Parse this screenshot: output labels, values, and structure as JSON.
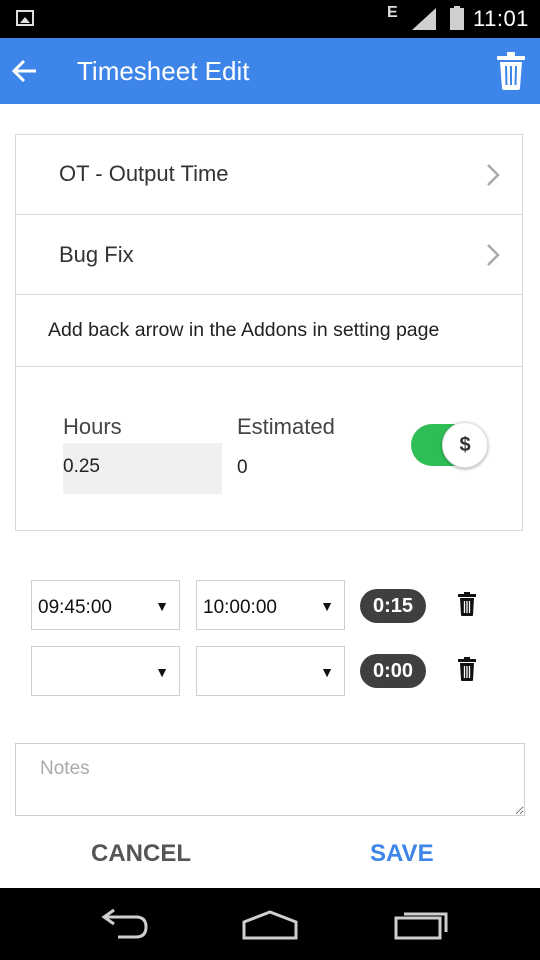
{
  "status_bar": {
    "network": "E",
    "time": "11:01"
  },
  "app_bar": {
    "title": "Timesheet Edit"
  },
  "card": {
    "project": "OT - Output Time",
    "task": "Bug Fix",
    "description": "Add back arrow in the Addons in setting page",
    "hours_label": "Hours",
    "hours_value": "0.25",
    "estimated_label": "Estimated",
    "estimated_value": "0",
    "billable_symbol": "$",
    "billable_on": true
  },
  "time_entries": [
    {
      "start": "09:45:00",
      "end": "10:00:00",
      "duration": "0:15"
    },
    {
      "start": "",
      "end": "",
      "duration": "0:00"
    }
  ],
  "notes": {
    "placeholder": "Notes",
    "value": ""
  },
  "actions": {
    "cancel": "CANCEL",
    "save": "SAVE"
  },
  "colors": {
    "app_bar": "#3d85e8",
    "toggle_on": "#2fbd55",
    "pill": "#3f3f3f",
    "save": "#3d85e8"
  },
  "icons": {
    "back": "arrow-left-icon",
    "delete": "trash-icon",
    "chevron": "chevron-right-icon"
  }
}
